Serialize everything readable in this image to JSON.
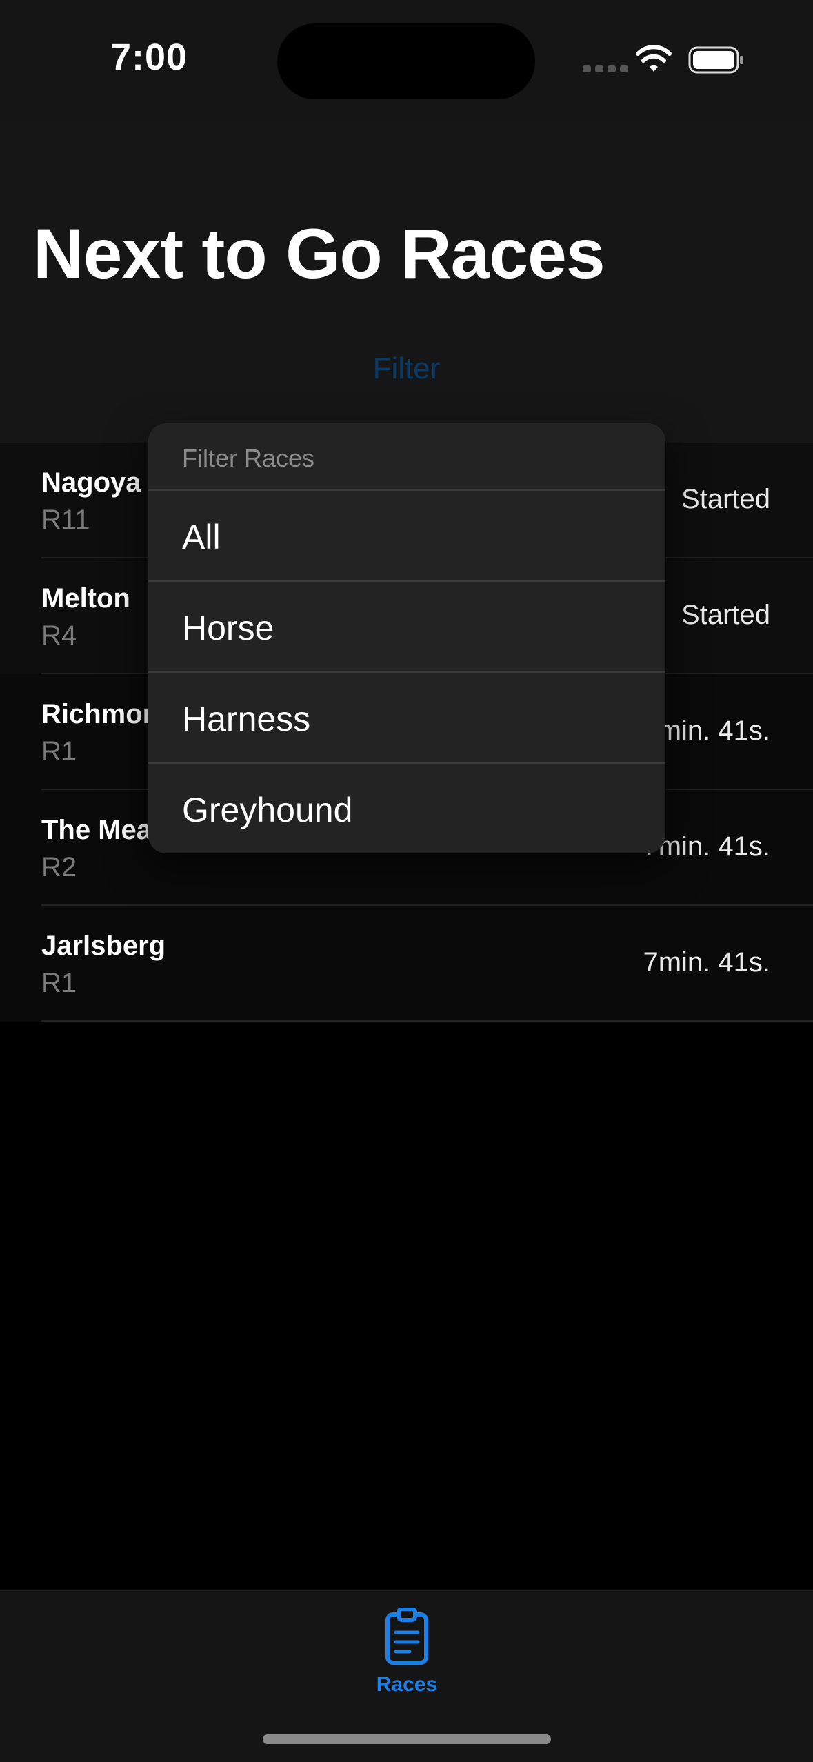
{
  "status_bar": {
    "time": "7:00"
  },
  "header": {
    "title": "Next to Go Races",
    "filter_label": "Filter"
  },
  "races": [
    {
      "track": "Nagoya",
      "race": "R11",
      "status": "Started"
    },
    {
      "track": "Melton",
      "race": "R4",
      "status": "Started"
    },
    {
      "track": "Richmon",
      "race": "R1",
      "status": "min. 41s."
    },
    {
      "track": "The Mea",
      "race": "R2",
      "status": "7min. 41s."
    },
    {
      "track": "Jarlsberg",
      "race": "R1",
      "status": "7min. 41s."
    }
  ],
  "filter_menu": {
    "title": "Filter Races",
    "options": [
      "All",
      "Horse",
      "Harness",
      "Greyhound"
    ]
  },
  "tab_bar": {
    "races_label": "Races",
    "icon": "clipboard-icon",
    "accent": "#1c7fe6"
  }
}
